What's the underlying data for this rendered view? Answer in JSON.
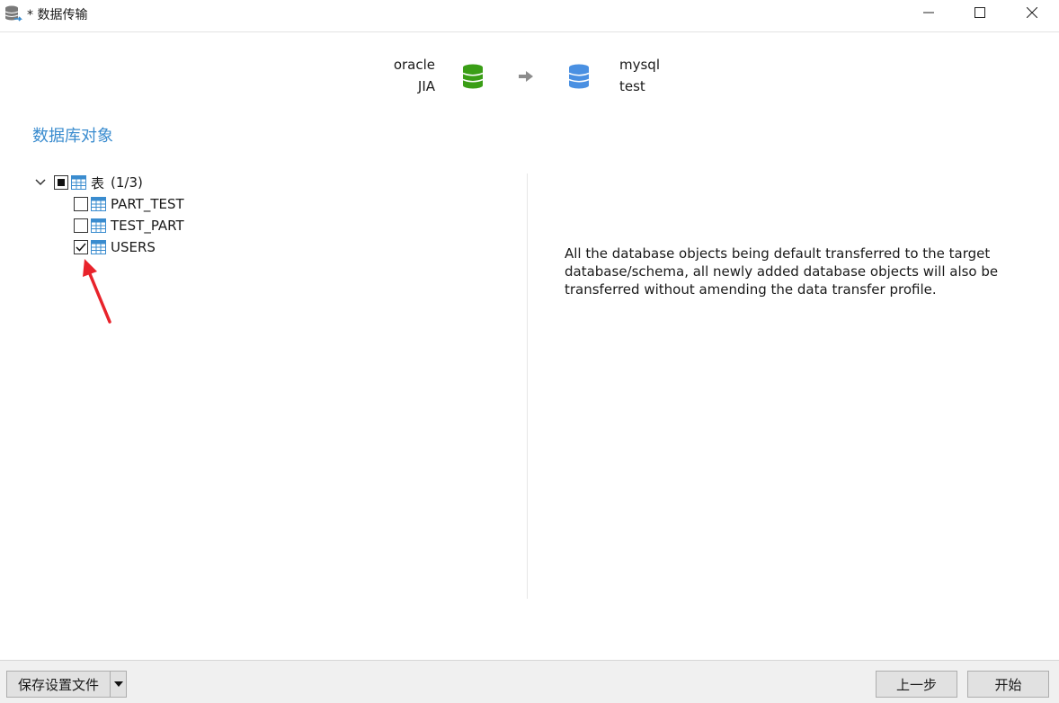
{
  "window": {
    "title": "* 数据传输",
    "controls": [
      "minimize-icon",
      "maximize-icon",
      "close-icon"
    ]
  },
  "connection": {
    "source": {
      "name": "oracle",
      "database": "JIA",
      "icon": "database-icon",
      "color": "#3a9e16"
    },
    "target": {
      "name": "mysql",
      "database": "test",
      "icon": "database-icon",
      "color": "#4a90e2"
    },
    "arrow_icon": "arrow-right-icon"
  },
  "section_title": "数据库对象",
  "tree": {
    "root": {
      "label": "表",
      "count": "(1/3)",
      "state": "partial",
      "expanded": true
    },
    "items": [
      {
        "label": "PART_TEST",
        "checked": false
      },
      {
        "label": "TEST_PART",
        "checked": false
      },
      {
        "label": "USERS",
        "checked": true
      }
    ]
  },
  "description": "All the database objects being default transferred to the target database/schema, all newly added database objects will also be transferred without amending the data transfer profile.",
  "footer": {
    "save_label": "保存设置文件",
    "prev_label": "上一步",
    "start_label": "开始"
  },
  "accent_color": "#3a8ccf"
}
